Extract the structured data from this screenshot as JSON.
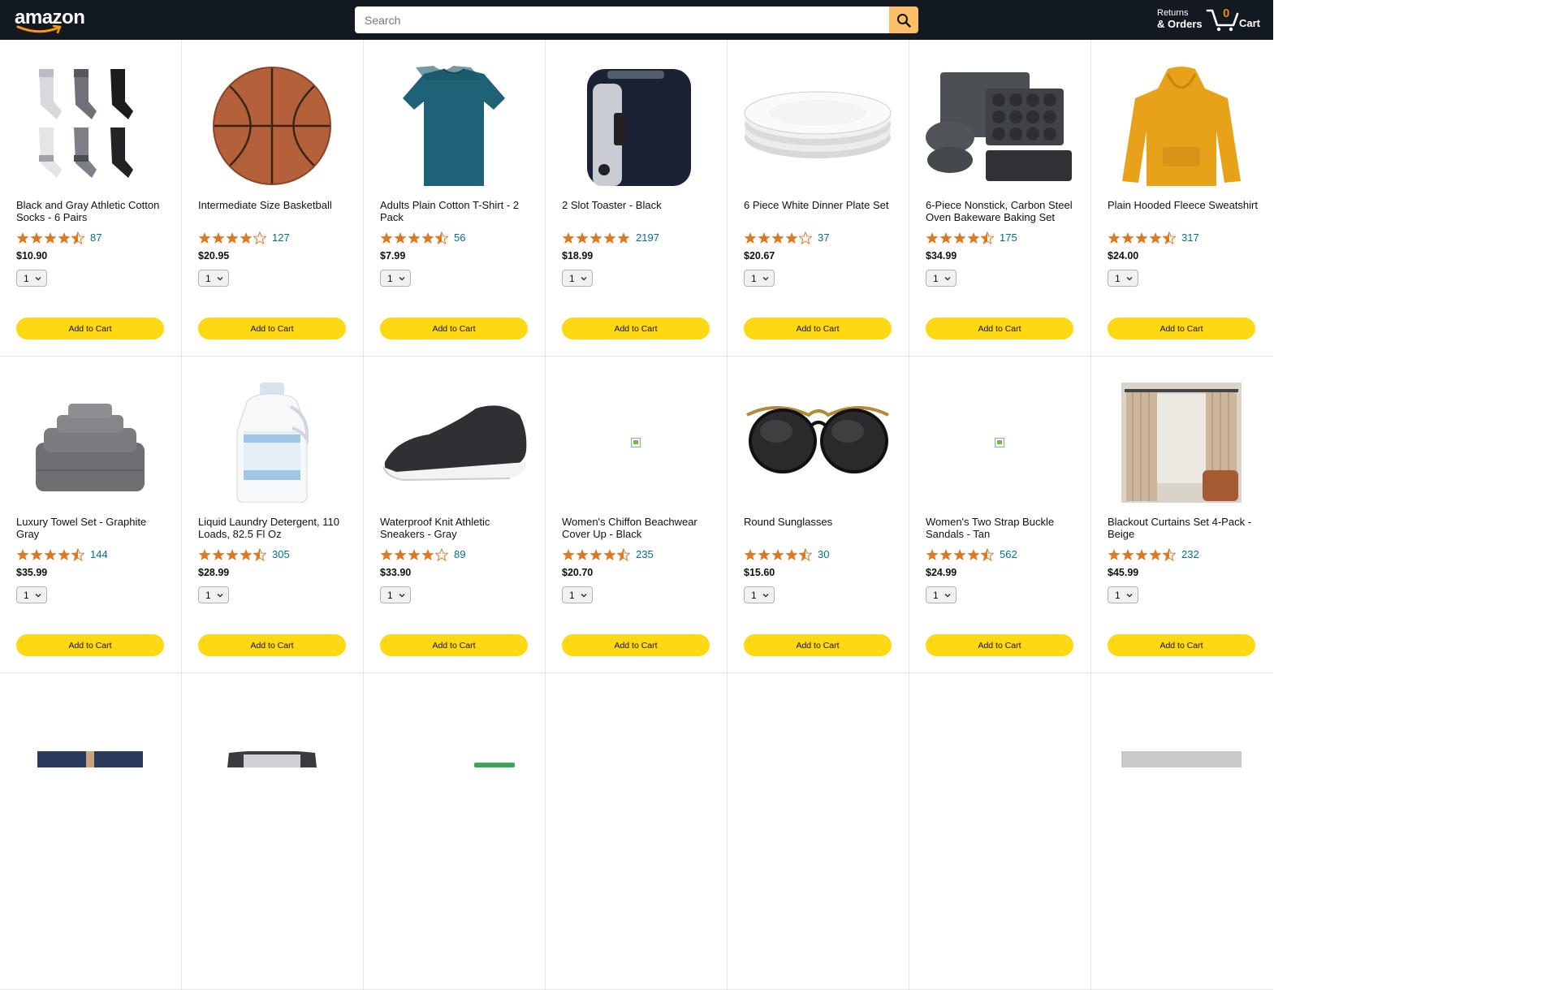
{
  "header": {
    "logo_text": "amazon",
    "search_placeholder": "Search",
    "returns_line1": "Returns",
    "returns_line2": "& Orders",
    "cart_count": "0",
    "cart_label": "Cart"
  },
  "colors": {
    "header_bg": "#131921",
    "search_button": "#febd69",
    "add_button": "#ffd814",
    "star": "#de7921",
    "link": "#007185"
  },
  "products": [
    {
      "title": "Black and Gray Athletic Cotton Socks - 6 Pairs",
      "rating": 4.5,
      "count": "87",
      "price": "$10.90",
      "qty": "1",
      "button": "Add to Cart",
      "image": "socks"
    },
    {
      "title": "Intermediate Size Basketball",
      "rating": 4,
      "count": "127",
      "price": "$20.95",
      "qty": "1",
      "button": "Add to Cart",
      "image": "basketball"
    },
    {
      "title": "Adults Plain Cotton T-Shirt - 2 Pack",
      "rating": 4.5,
      "count": "56",
      "price": "$7.99",
      "qty": "1",
      "button": "Add to Cart",
      "image": "tshirt"
    },
    {
      "title": "2 Slot Toaster - Black",
      "rating": 5,
      "count": "2197",
      "price": "$18.99",
      "qty": "1",
      "button": "Add to Cart",
      "image": "toaster"
    },
    {
      "title": "6 Piece White Dinner Plate Set",
      "rating": 4,
      "count": "37",
      "price": "$20.67",
      "qty": "1",
      "button": "Add to Cart",
      "image": "plates"
    },
    {
      "title": "6-Piece Nonstick, Carbon Steel Oven Bakeware Baking Set",
      "rating": 4.5,
      "count": "175",
      "price": "$34.99",
      "qty": "1",
      "button": "Add to Cart",
      "image": "bakeware"
    },
    {
      "title": "Plain Hooded Fleece Sweatshirt",
      "rating": 4.5,
      "count": "317",
      "price": "$24.00",
      "qty": "1",
      "button": "Add to Cart",
      "image": "hoodie"
    },
    {
      "title": "Luxury Towel Set - Graphite Gray",
      "rating": 4.5,
      "count": "144",
      "price": "$35.99",
      "qty": "1",
      "button": "Add to Cart",
      "image": "towels"
    },
    {
      "title": "Liquid Laundry Detergent, 110 Loads, 82.5 Fl Oz",
      "rating": 4.5,
      "count": "305",
      "price": "$28.99",
      "qty": "1",
      "button": "Add to Cart",
      "image": "detergent"
    },
    {
      "title": "Waterproof Knit Athletic Sneakers - Gray",
      "rating": 4,
      "count": "89",
      "price": "$33.90",
      "qty": "1",
      "button": "Add to Cart",
      "image": "sneaker"
    },
    {
      "title": "Women's Chiffon Beachwear Cover Up - Black",
      "rating": 4.5,
      "count": "235",
      "price": "$20.70",
      "qty": "1",
      "button": "Add to Cart",
      "image": "broken"
    },
    {
      "title": "Round Sunglasses",
      "rating": 4.5,
      "count": "30",
      "price": "$15.60",
      "qty": "1",
      "button": "Add to Cart",
      "image": "sunglasses"
    },
    {
      "title": "Women's Two Strap Buckle Sandals - Tan",
      "rating": 4.5,
      "count": "562",
      "price": "$24.99",
      "qty": "1",
      "button": "Add to Cart",
      "image": "broken"
    },
    {
      "title": "Blackout Curtains Set 4-Pack - Beige",
      "rating": 4.5,
      "count": "232",
      "price": "$45.99",
      "qty": "1",
      "button": "Add to Cart",
      "image": "curtains"
    },
    {
      "title": "",
      "rating": null,
      "count": "",
      "price": "",
      "qty": "",
      "button": "",
      "image": "jeans"
    },
    {
      "title": "",
      "rating": null,
      "count": "",
      "price": "",
      "qty": "",
      "button": "",
      "image": "kettle"
    },
    {
      "title": "",
      "rating": null,
      "count": "",
      "price": "",
      "qty": "",
      "button": "",
      "image": "green"
    },
    {
      "title": "",
      "rating": null,
      "count": "",
      "price": "",
      "qty": "",
      "button": "",
      "image": "none"
    },
    {
      "title": "",
      "rating": null,
      "count": "",
      "price": "",
      "qty": "",
      "button": "",
      "image": "none"
    },
    {
      "title": "",
      "rating": null,
      "count": "",
      "price": "",
      "qty": "",
      "button": "",
      "image": "none"
    },
    {
      "title": "",
      "rating": null,
      "count": "",
      "price": "",
      "qty": "",
      "button": "",
      "image": "gray"
    }
  ]
}
